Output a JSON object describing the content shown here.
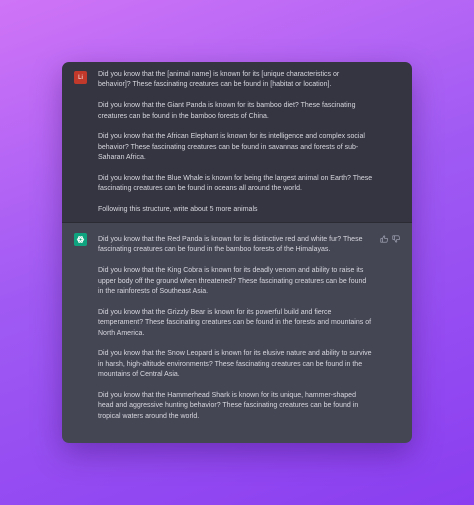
{
  "user_message": {
    "avatar_label": "Li",
    "paragraphs": [
      "Did you know that the [animal name] is known for its [unique characteristics or behavior]? These fascinating creatures can be found in [habitat or location].",
      "Did you know that the Giant Panda is known for its bamboo diet? These fascinating creatures can be found in the bamboo forests of China.",
      "Did you know that the African Elephant is known for its intelligence and complex social behavior? These fascinating creatures can be found in savannas and forests of sub-Saharan Africa.",
      "Did you know that the Blue Whale is known for being the largest animal on Earth? These fascinating creatures can be found in oceans all around the world.",
      "Following this structure, write about 5 more animals"
    ]
  },
  "assistant_message": {
    "avatar_icon": "openai-logo-icon",
    "paragraphs": [
      "Did you know that the Red Panda is known for its distinctive red and white fur? These fascinating creatures can be found in the bamboo forests of the Himalayas.",
      "Did you know that the King Cobra is known for its deadly venom and ability to raise its upper body off the ground when threatened? These fascinating creatures can be found in the rainforests of Southeast Asia.",
      "Did you know that the Grizzly Bear is known for its powerful build and fierce temperament? These fascinating creatures can be found in the forests and mountains of North America.",
      "Did you know that the Snow Leopard is known for its elusive nature and ability to survive in harsh, high-altitude environments? These fascinating creatures can be found in the mountains of Central Asia.",
      "Did you know that the Hammerhead Shark is known for its unique, hammer-shaped head and aggressive hunting behavior? These fascinating creatures can be found in tropical waters around the world."
    ]
  },
  "colors": {
    "user_bg": "#343541",
    "assistant_bg": "#444654",
    "text": "#d7d7de",
    "user_avatar": "#c0392b",
    "assistant_avatar": "#10a37f"
  }
}
